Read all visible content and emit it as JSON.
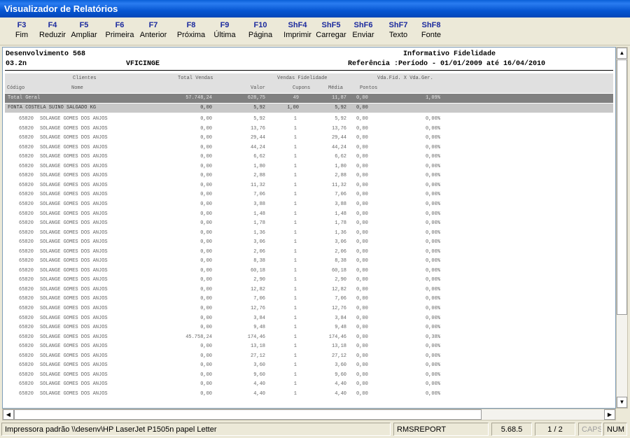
{
  "window": {
    "title": "Visualizador de Relatórios"
  },
  "toolbar": [
    {
      "key": "F3",
      "label": "Fim"
    },
    {
      "key": "F4",
      "label": "Reduzir"
    },
    {
      "key": "F5",
      "label": "Ampliar"
    },
    {
      "key": "F6",
      "label": "Primeira"
    },
    {
      "key": "F7",
      "label": "Anterior"
    },
    {
      "key": "F8",
      "label": "Próxima"
    },
    {
      "key": "F9",
      "label": "Última"
    },
    {
      "key": "F10",
      "label": "Página"
    },
    {
      "key": "ShF4",
      "label": "Imprimir"
    },
    {
      "key": "ShF5",
      "label": "Carregar"
    },
    {
      "key": "ShF6",
      "label": "Enviar"
    },
    {
      "key": "ShF7",
      "label": "Texto"
    },
    {
      "key": "ShF8",
      "label": "Fonte"
    }
  ],
  "report": {
    "company": "Desenvolvimento 568",
    "code": "03.2n",
    "program": "VFICINGE",
    "title": "Informativo Fidelidade",
    "reference": "Referência :Período - 01/01/2009 até 16/04/2010",
    "headers": {
      "clientes": "Clientes",
      "total_vendas": "Total Vendas",
      "vendas_fidelidade": "Vendas Fidelidade",
      "vda_fid": "Vda.Fid. X Vda.Ger.",
      "codigo": "Código",
      "nome": "Nome",
      "valor": "Valor",
      "cupons": "Cupons",
      "media": "Média",
      "pontos": "Pontos"
    },
    "total": {
      "label": "Total Geral",
      "total": "57.748,24",
      "valor": "628,75",
      "cupons": "49",
      "media": "11,87",
      "pontos": "0,00",
      "pct": "1,09%"
    },
    "group": {
      "label": "FONTA COSTELA SUINO SALGADO KG",
      "total": "0,00",
      "valor": "5,92",
      "cupons": "1,00",
      "media": "5,92",
      "pontos": "0,00"
    },
    "rows": [
      {
        "code": "65820",
        "name": "SOLANGE GOMES DOS ANJOS",
        "total": "0,00",
        "valor": "5,92",
        "cupons": "1",
        "media": "5,92",
        "pontos": "0,00",
        "pct": "0,00%"
      },
      {
        "code": "65820",
        "name": "SOLANGE GOMES DOS ANJOS",
        "total": "0,00",
        "valor": "13,76",
        "cupons": "1",
        "media": "13,76",
        "pontos": "0,00",
        "pct": "0,00%"
      },
      {
        "code": "65820",
        "name": "SOLANGE GOMES DOS ANJOS",
        "total": "0,00",
        "valor": "29,44",
        "cupons": "1",
        "media": "29,44",
        "pontos": "0,00",
        "pct": "0,00%"
      },
      {
        "code": "65820",
        "name": "SOLANGE GOMES DOS ANJOS",
        "total": "0,00",
        "valor": "44,24",
        "cupons": "1",
        "media": "44,24",
        "pontos": "0,00",
        "pct": "0,00%"
      },
      {
        "code": "65820",
        "name": "SOLANGE GOMES DOS ANJOS",
        "total": "0,00",
        "valor": "6,62",
        "cupons": "1",
        "media": "6,62",
        "pontos": "0,00",
        "pct": "0,00%"
      },
      {
        "code": "65820",
        "name": "SOLANGE GOMES DOS ANJOS",
        "total": "0,00",
        "valor": "1,80",
        "cupons": "1",
        "media": "1,80",
        "pontos": "0,00",
        "pct": "0,00%"
      },
      {
        "code": "65820",
        "name": "SOLANGE GOMES DOS ANJOS",
        "total": "0,00",
        "valor": "2,88",
        "cupons": "1",
        "media": "2,88",
        "pontos": "0,00",
        "pct": "0,00%"
      },
      {
        "code": "65820",
        "name": "SOLANGE GOMES DOS ANJOS",
        "total": "0,00",
        "valor": "11,32",
        "cupons": "1",
        "media": "11,32",
        "pontos": "0,00",
        "pct": "0,00%"
      },
      {
        "code": "65820",
        "name": "SOLANGE GOMES DOS ANJOS",
        "total": "0,00",
        "valor": "7,06",
        "cupons": "1",
        "media": "7,06",
        "pontos": "0,00",
        "pct": "0,00%"
      },
      {
        "code": "65820",
        "name": "SOLANGE GOMES DOS ANJOS",
        "total": "0,00",
        "valor": "3,88",
        "cupons": "1",
        "media": "3,88",
        "pontos": "0,00",
        "pct": "0,00%"
      },
      {
        "code": "65820",
        "name": "SOLANGE GOMES DOS ANJOS",
        "total": "0,00",
        "valor": "1,48",
        "cupons": "1",
        "media": "1,48",
        "pontos": "0,00",
        "pct": "0,00%"
      },
      {
        "code": "65820",
        "name": "SOLANGE GOMES DOS ANJOS",
        "total": "0,00",
        "valor": "1,78",
        "cupons": "1",
        "media": "1,78",
        "pontos": "0,00",
        "pct": "0,00%"
      },
      {
        "code": "65820",
        "name": "SOLANGE GOMES DOS ANJOS",
        "total": "0,00",
        "valor": "1,36",
        "cupons": "1",
        "media": "1,36",
        "pontos": "0,00",
        "pct": "0,00%"
      },
      {
        "code": "65820",
        "name": "SOLANGE GOMES DOS ANJOS",
        "total": "0,00",
        "valor": "3,06",
        "cupons": "1",
        "media": "3,06",
        "pontos": "0,00",
        "pct": "0,00%"
      },
      {
        "code": "65820",
        "name": "SOLANGE GOMES DOS ANJOS",
        "total": "0,00",
        "valor": "2,06",
        "cupons": "1",
        "media": "2,06",
        "pontos": "0,00",
        "pct": "0,00%"
      },
      {
        "code": "65820",
        "name": "SOLANGE GOMES DOS ANJOS",
        "total": "0,00",
        "valor": "8,38",
        "cupons": "1",
        "media": "8,38",
        "pontos": "0,00",
        "pct": "0,00%"
      },
      {
        "code": "65820",
        "name": "SOLANGE GOMES DOS ANJOS",
        "total": "0,00",
        "valor": "60,18",
        "cupons": "1",
        "media": "60,18",
        "pontos": "0,00",
        "pct": "0,00%"
      },
      {
        "code": "65820",
        "name": "SOLANGE GOMES DOS ANJOS",
        "total": "0,00",
        "valor": "2,90",
        "cupons": "1",
        "media": "2,90",
        "pontos": "0,00",
        "pct": "0,00%"
      },
      {
        "code": "65820",
        "name": "SOLANGE GOMES DOS ANJOS",
        "total": "0,00",
        "valor": "12,82",
        "cupons": "1",
        "media": "12,82",
        "pontos": "0,00",
        "pct": "0,00%"
      },
      {
        "code": "65820",
        "name": "SOLANGE GOMES DOS ANJOS",
        "total": "0,00",
        "valor": "7,06",
        "cupons": "1",
        "media": "7,06",
        "pontos": "0,00",
        "pct": "0,00%"
      },
      {
        "code": "65820",
        "name": "SOLANGE GOMES DOS ANJOS",
        "total": "0,00",
        "valor": "12,76",
        "cupons": "1",
        "media": "12,76",
        "pontos": "0,00",
        "pct": "0,00%"
      },
      {
        "code": "65820",
        "name": "SOLANGE GOMES DOS ANJOS",
        "total": "0,00",
        "valor": "3,84",
        "cupons": "1",
        "media": "3,84",
        "pontos": "0,00",
        "pct": "0,00%"
      },
      {
        "code": "65820",
        "name": "SOLANGE GOMES DOS ANJOS",
        "total": "0,00",
        "valor": "9,48",
        "cupons": "1",
        "media": "9,48",
        "pontos": "0,00",
        "pct": "0,00%"
      },
      {
        "code": "65820",
        "name": "SOLANGE GOMES DOS ANJOS",
        "total": "45.758,24",
        "valor": "174,46",
        "cupons": "1",
        "media": "174,46",
        "pontos": "0,00",
        "pct": "0,38%"
      },
      {
        "code": "65820",
        "name": "SOLANGE GOMES DOS ANJOS",
        "total": "0,00",
        "valor": "13,18",
        "cupons": "1",
        "media": "13,18",
        "pontos": "0,00",
        "pct": "0,00%"
      },
      {
        "code": "65820",
        "name": "SOLANGE GOMES DOS ANJOS",
        "total": "0,00",
        "valor": "27,12",
        "cupons": "1",
        "media": "27,12",
        "pontos": "0,00",
        "pct": "0,00%"
      },
      {
        "code": "65820",
        "name": "SOLANGE GOMES DOS ANJOS",
        "total": "0,00",
        "valor": "3,60",
        "cupons": "1",
        "media": "3,60",
        "pontos": "0,00",
        "pct": "0,00%"
      },
      {
        "code": "65820",
        "name": "SOLANGE GOMES DOS ANJOS",
        "total": "0,00",
        "valor": "9,60",
        "cupons": "1",
        "media": "9,60",
        "pontos": "0,00",
        "pct": "0,00%"
      },
      {
        "code": "65820",
        "name": "SOLANGE GOMES DOS ANJOS",
        "total": "0,00",
        "valor": "4,40",
        "cupons": "1",
        "media": "4,40",
        "pontos": "0,00",
        "pct": "0,00%"
      },
      {
        "code": "65820",
        "name": "SOLANGE GOMES DOS ANJOS",
        "total": "0,00",
        "valor": "4,40",
        "cupons": "1",
        "media": "4,40",
        "pontos": "0,00",
        "pct": "0,00%"
      }
    ]
  },
  "status": {
    "printer": "Impressora padrão \\\\desenv\\HP LaserJet P1505n papel Letter",
    "report_name": "RMSREPORT",
    "version": "5.68.5",
    "page": "1 / 2",
    "caps": "CAPS",
    "num": "NUM"
  },
  "icons": {
    "scroll_up": "▲",
    "scroll_down": "▼",
    "scroll_left": "◀",
    "scroll_right": "▶"
  }
}
